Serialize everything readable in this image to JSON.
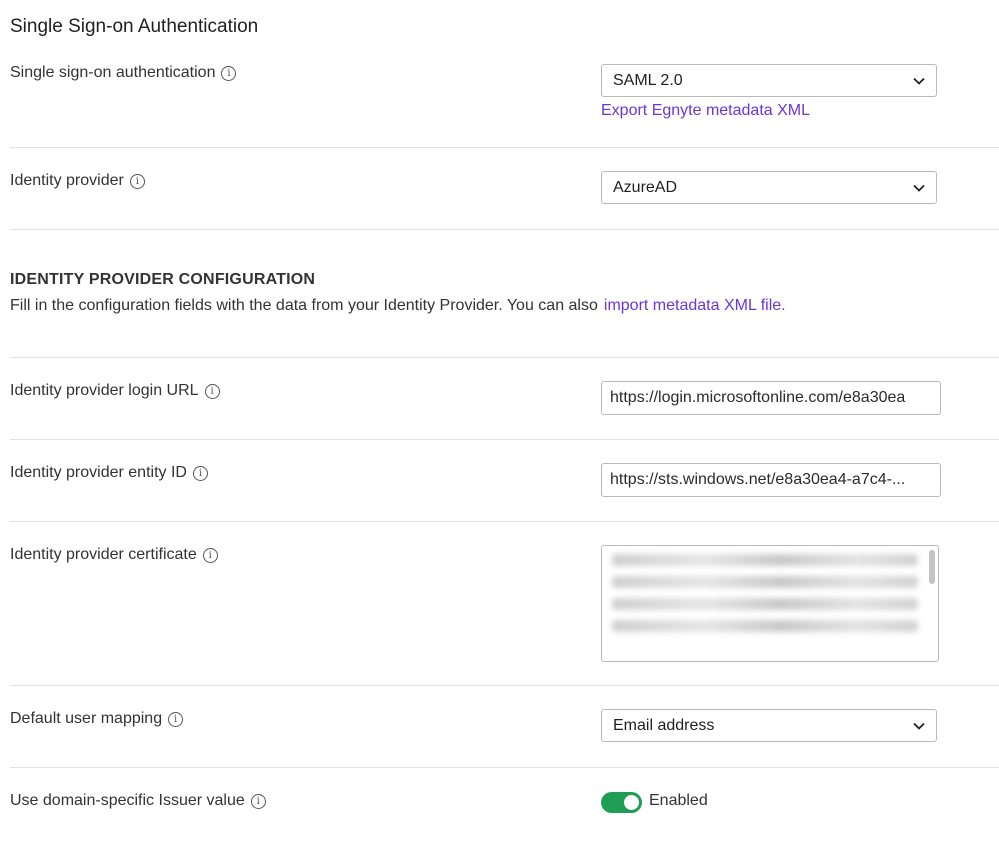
{
  "page": {
    "title": "Single Sign-on Authentication"
  },
  "sso": {
    "label": "Single sign-on authentication",
    "value": "SAML 2.0",
    "export_link": "Export Egnyte metadata XML"
  },
  "idp": {
    "label": "Identity provider",
    "value": "AzureAD"
  },
  "config": {
    "heading": "IDENTITY PROVIDER CONFIGURATION",
    "description": "Fill in the configuration fields with the data from your Identity Provider. You can also",
    "import_link": "import metadata XML file."
  },
  "login_url": {
    "label": "Identity provider login URL",
    "value": "https://login.microsoftonline.com/e8a30ea"
  },
  "entity_id": {
    "label": "Identity provider entity ID",
    "value": "https://sts.windows.net/e8a30ea4-a7c4-..."
  },
  "certificate": {
    "label": "Identity provider certificate"
  },
  "mapping": {
    "label": "Default user mapping",
    "value": "Email address"
  },
  "issuer": {
    "label": "Use domain-specific Issuer value",
    "state": "Enabled"
  },
  "colors": {
    "link": "#6a37d6",
    "toggle_on": "#1f9d55"
  },
  "icons": {
    "info": "info-icon",
    "dropdown": "chevron-down-icon"
  }
}
